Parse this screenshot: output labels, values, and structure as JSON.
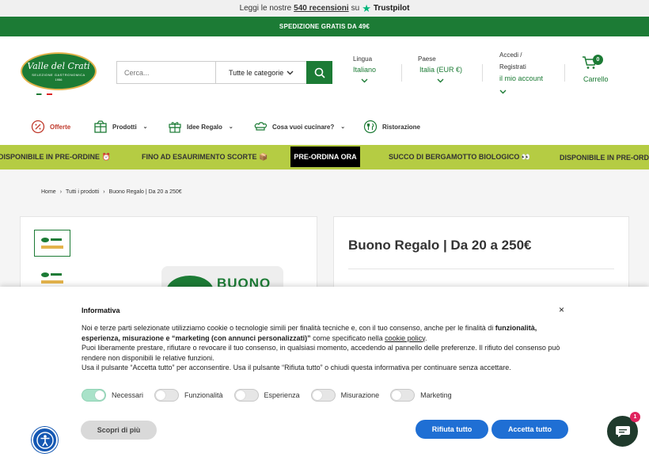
{
  "review_bar": {
    "prefix": "Leggi le nostre",
    "count": "540 recensioni",
    "suffix": "su",
    "brand": "Trustpilot"
  },
  "ship_bar": {
    "text": "SPEDIZIONE GRATIS DA 49€"
  },
  "logo": {
    "name": "Valle del Crati",
    "tagline": "SELEZIONE GASTRONOMICA",
    "year": "1956"
  },
  "search": {
    "placeholder": "Cerca...",
    "category": "Tutte le categorie"
  },
  "header": {
    "language_label": "Lingua",
    "language_value": "Italiano",
    "country_label": "Paese",
    "country_value": "Italia (EUR €)",
    "account_line1": "Accedi /",
    "account_line2": "Registrati",
    "account_value": "il mio account",
    "cart_count": "0",
    "cart_label": "Carrello"
  },
  "nav": {
    "offers": "Offerte",
    "products": "Prodotti",
    "gifts": "Idee Regalo",
    "cook": "Cosa vuoi cucinare?",
    "catering": "Ristorazione"
  },
  "marquee": {
    "item1": "DISPONIBILE IN PRE-ORDINE ⏰",
    "item2": "FINO AD ESAURIMENTO SCORTE 📦",
    "cta": "PRE-ORDINA ORA",
    "item3": "SUCCO DI BERGAMOTTO BIOLOGICO 👀",
    "item4": "DISPONIBILE IN PRE-ORDINE"
  },
  "breadcrumb": {
    "home": "Home",
    "all": "Tutti i prodotti",
    "current": "Buono Regalo | Da 20 a 250€"
  },
  "product": {
    "title": "Buono Regalo | Da 20 a 250€",
    "hero_text": "BUONO"
  },
  "cookie": {
    "title": "Informativa",
    "p1_a": "Noi e terze parti selezionate utilizziamo cookie o tecnologie simili per finalità tecniche e, con il tuo consenso, anche per le finalità di ",
    "p1_b": "funzionalità, esperienza, misurazione e “marketing (con annunci personalizzati)”",
    "p1_c": " come specificato nella ",
    "p1_link": "cookie policy",
    "p1_d": ".",
    "p2": "Puoi liberamente prestare, rifiutare o revocare il tuo consenso, in qualsiasi momento, accedendo al pannello delle preferenze. Il rifiuto del consenso può rendere non disponibili le relative funzioni.",
    "p3": "Usa il pulsante “Accetta tutto” per acconsentire. Usa il pulsante “Rifiuta tutto” o chiudi questa informativa per continuare senza accettare.",
    "toggles": [
      "Necessari",
      "Funzionalità",
      "Esperienza",
      "Misurazione",
      "Marketing"
    ],
    "learn_more": "Scopri di più",
    "reject": "Rifiuta tutto",
    "accept": "Accetta tutto",
    "close": "×"
  },
  "chat": {
    "badge": "1"
  },
  "colors": {
    "brand_green": "#1c7b35",
    "marquee": "#b5cc43",
    "cookie_button": "#1f6fd4"
  }
}
